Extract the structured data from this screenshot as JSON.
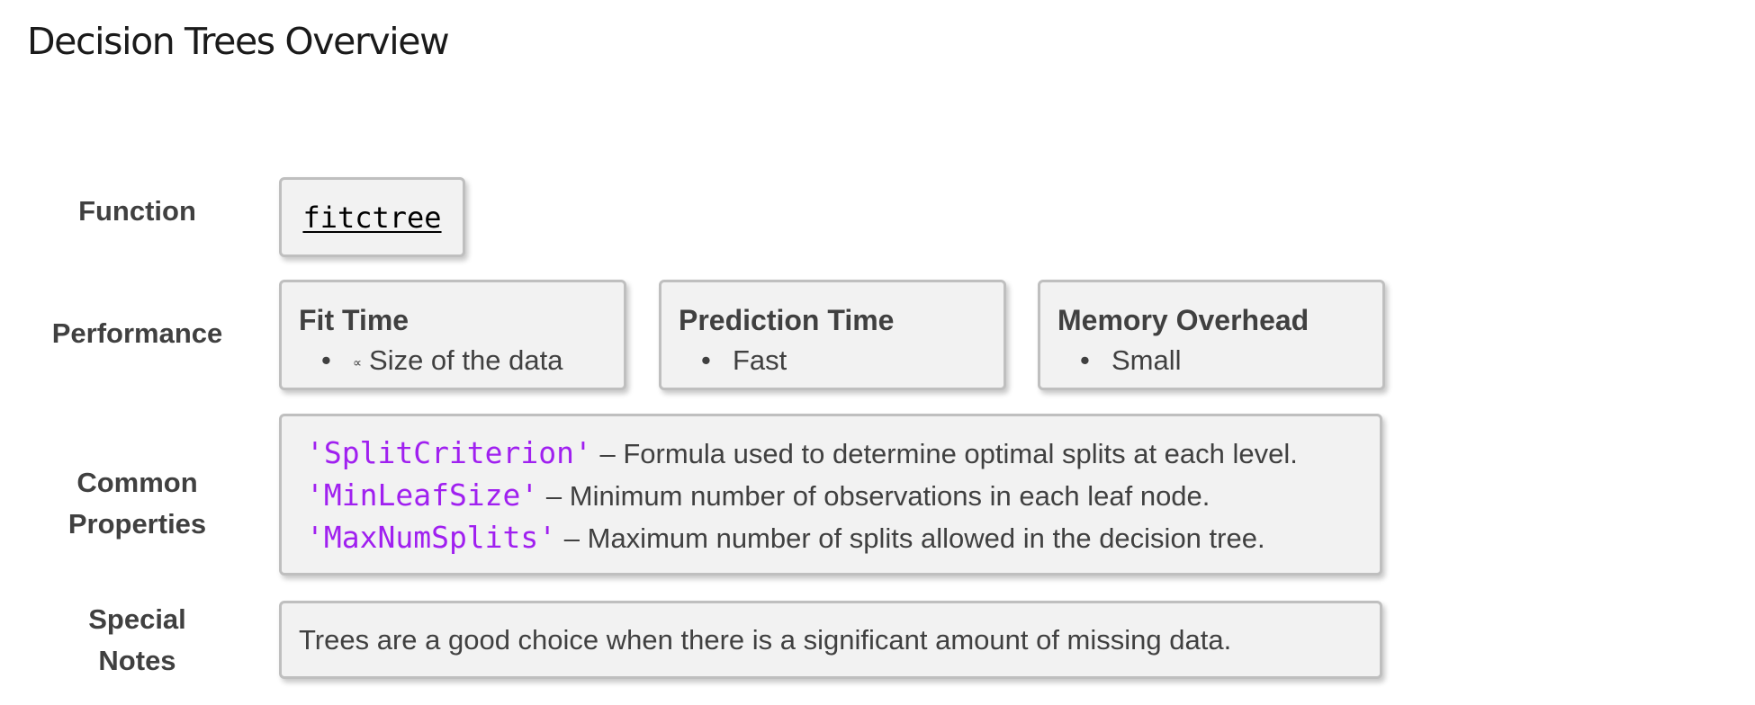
{
  "title": "Decision Trees Overview",
  "labels": {
    "function": "Function",
    "performance": "Performance",
    "common_properties": [
      "Common",
      "Properties"
    ],
    "special_notes": [
      "Special",
      "Notes"
    ]
  },
  "function_name": "fitctree",
  "performance": [
    {
      "title": "Fit Time",
      "item": "Size of the data",
      "icon": "proportional-icon"
    },
    {
      "title": "Prediction Time",
      "item": "Fast"
    },
    {
      "title": "Memory Overhead",
      "item": "Small"
    }
  ],
  "bullet": "•",
  "proportional_symbol": "∝",
  "properties": [
    {
      "name": "'SplitCriterion'",
      "description": " – Formula used to determine optimal splits at each level."
    },
    {
      "name": "'MinLeafSize'",
      "description": " – Minimum number of observations in each leaf node."
    },
    {
      "name": "'MaxNumSplits'",
      "description": " – Maximum number of splits allowed in the decision tree."
    }
  ],
  "special_notes": "Trees are a good choice when there is a significant amount of missing data.",
  "colors": {
    "property_name": "#a020f0",
    "box_background": "#f2f2f2",
    "box_border": "#bfbfbf",
    "text": "#404040"
  }
}
